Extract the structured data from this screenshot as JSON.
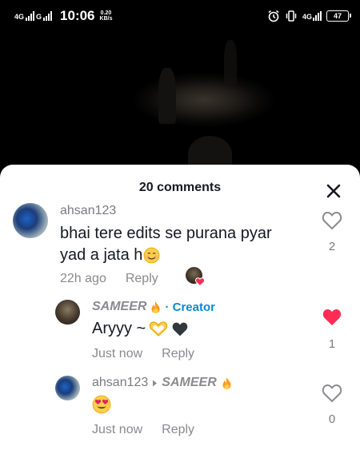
{
  "status_bar": {
    "network_top": "4G",
    "network_sub": "G",
    "time": "10:06",
    "speed_value": "0.20",
    "speed_unit": "KB/s",
    "net_right": "4G",
    "battery": "47"
  },
  "comments_sheet": {
    "title": "20 comments",
    "comments": [
      {
        "username": "ahsan123",
        "text": "bhai tere edits se purana pyar yad a jata h",
        "text_line1": "bhai tere edits se purana pyar",
        "text_line2": "yad a jata h",
        "time": "22h ago",
        "reply_label": "Reply",
        "likes": "2",
        "liked": false
      },
      {
        "username": "SAMEER",
        "creator_label": "· Creator",
        "text": "Aryyy ~",
        "time": "Just now",
        "reply_label": "Reply",
        "likes": "1",
        "liked": true
      },
      {
        "username": "ahsan123",
        "reply_to": "SAMEER",
        "text": "",
        "time": "Just now",
        "reply_label": "Reply",
        "likes": "0",
        "liked": false
      }
    ]
  },
  "icons": {
    "close": "close-icon",
    "heart": "heart-icon",
    "fire": "fire-emoji",
    "smile": "smiling-face-emoji",
    "heart_eyes": "heart-eyes-emoji",
    "heart_hands": "heart-hands-emoji",
    "black_heart": "black-heart-emoji"
  },
  "colors": {
    "liked_heart": "#fe2c55",
    "creator": "#0a8acf",
    "muted_text": "#8a8a8f",
    "primary_text": "#161823"
  }
}
